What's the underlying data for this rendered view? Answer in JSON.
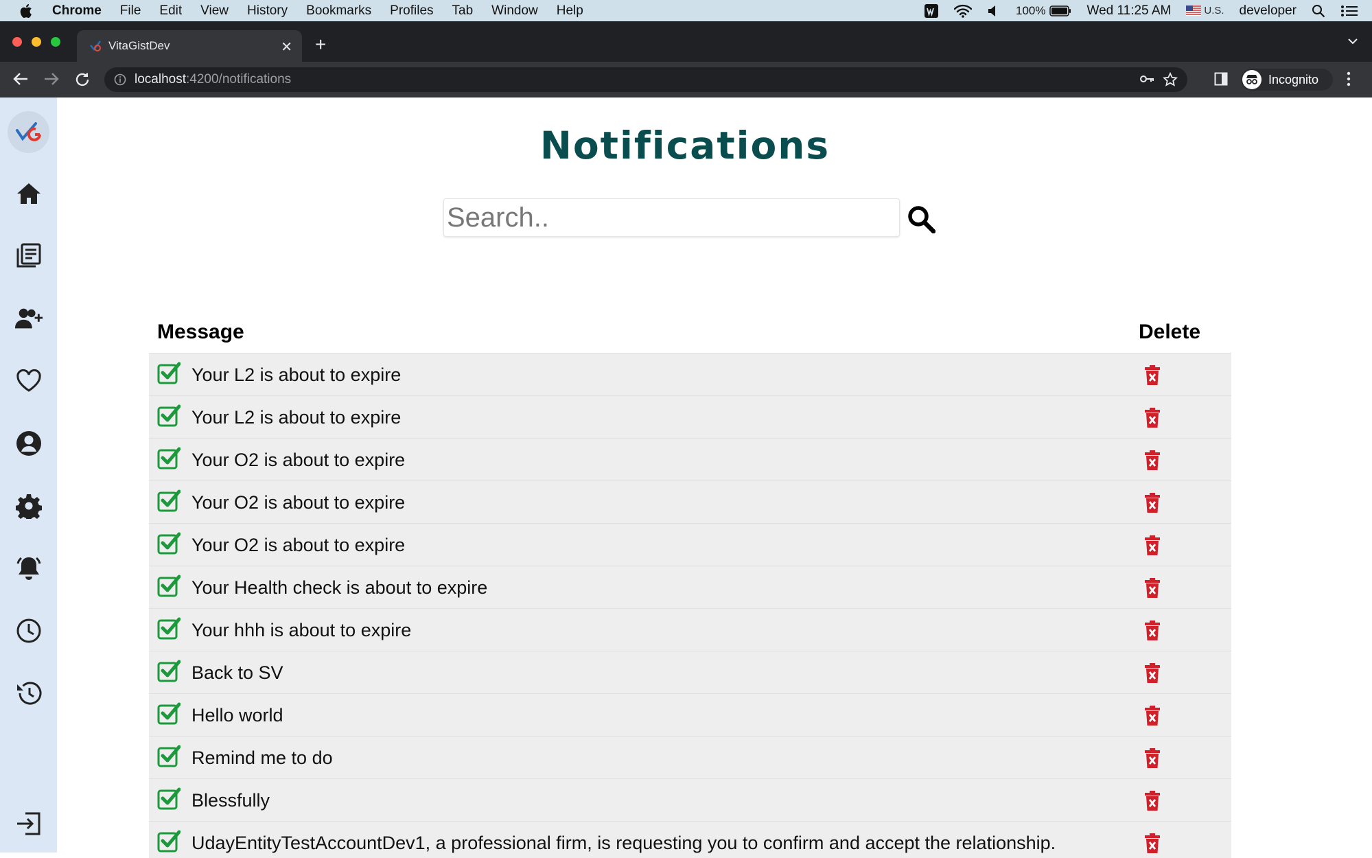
{
  "menubar": {
    "app": "Chrome",
    "items": [
      "File",
      "Edit",
      "View",
      "History",
      "Bookmarks",
      "Profiles",
      "Tab",
      "Window",
      "Help"
    ],
    "battery": "100%",
    "datetime": "Wed 11:25 AM",
    "keyboard": "U.S.",
    "user": "developer"
  },
  "browser": {
    "tab_title": "VitaGistDev",
    "url_host": "localhost",
    "url_path": ":4200/notifications",
    "profile": "Incognito"
  },
  "sidebar": {
    "items": [
      "logo",
      "home-icon",
      "documents-icon",
      "add-user-icon",
      "heart-icon",
      "profile-icon",
      "settings-icon",
      "notifications-bell-icon",
      "clock-icon",
      "history-icon",
      "logout-icon"
    ]
  },
  "page": {
    "title": "Notifications",
    "search_placeholder": "Search.."
  },
  "table": {
    "col_message": "Message",
    "col_delete": "Delete",
    "rows": [
      "Your L2 is about to expire",
      "Your L2 is about to expire",
      "Your O2 is about to expire",
      "Your O2 is about to expire",
      "Your O2 is about to expire",
      "Your Health check is about to expire",
      "Your hhh is about to expire",
      "Back to SV",
      "Hello world",
      "Remind me to do",
      "Blessfully",
      "UdayEntityTestAccountDev1, a professional firm, is requesting you to confirm and accept the relationship."
    ]
  },
  "colors": {
    "title": "#0a4d4f",
    "check": "#1a9a3a",
    "delete": "#d0202a",
    "sidebar_bg": "#dbe7f4"
  }
}
